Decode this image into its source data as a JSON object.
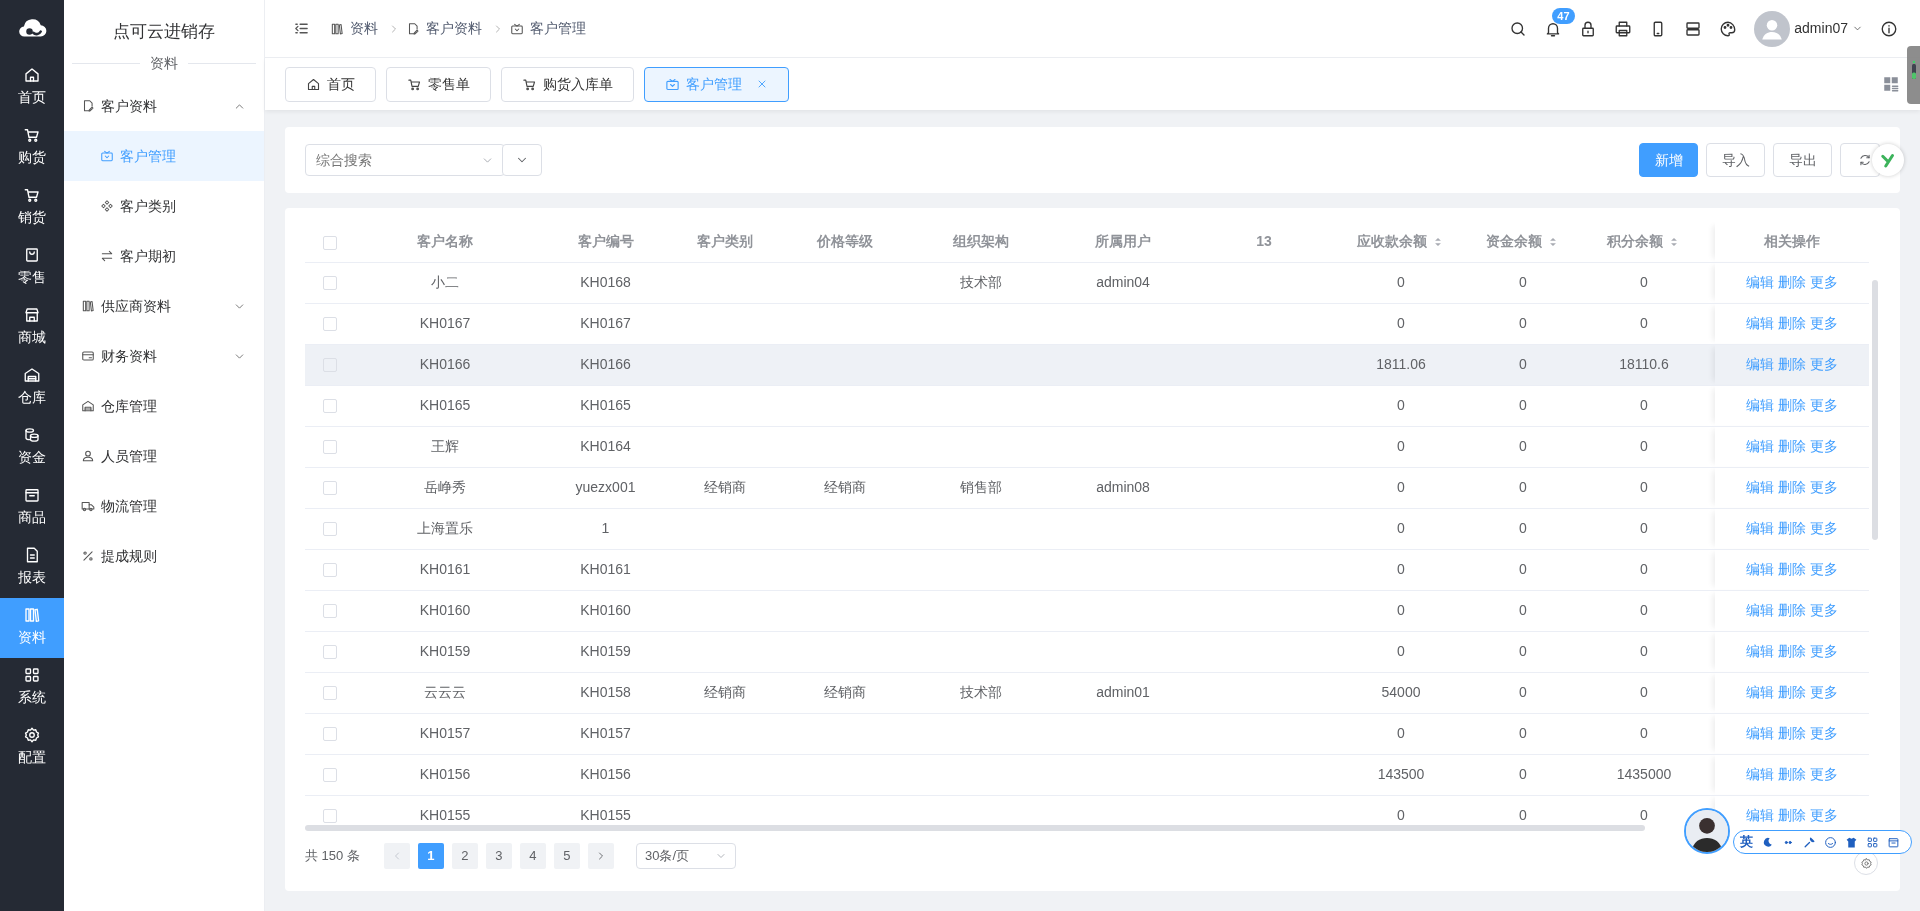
{
  "app": {
    "title": "点可云进销存",
    "section": "资料"
  },
  "nav_rail": [
    {
      "label": "首页",
      "selected": false
    },
    {
      "label": "购货",
      "selected": false
    },
    {
      "label": "销货",
      "selected": false
    },
    {
      "label": "零售",
      "selected": false
    },
    {
      "label": "商城",
      "selected": false
    },
    {
      "label": "仓库",
      "selected": false
    },
    {
      "label": "资金",
      "selected": false
    },
    {
      "label": "商品",
      "selected": false
    },
    {
      "label": "报表",
      "selected": false
    },
    {
      "label": "资料",
      "selected": true
    },
    {
      "label": "系统",
      "selected": false
    },
    {
      "label": "配置",
      "selected": false
    }
  ],
  "side_menu": [
    {
      "label": "客户资料",
      "kind": "group",
      "expanded": true,
      "selected": false,
      "children": [
        {
          "label": "客户管理",
          "selected": true
        },
        {
          "label": "客户类别",
          "selected": false
        },
        {
          "label": "客户期初",
          "selected": false
        }
      ]
    },
    {
      "label": "供应商资料",
      "kind": "group",
      "expanded": false,
      "selected": false
    },
    {
      "label": "财务资料",
      "kind": "group",
      "expanded": false,
      "selected": false
    },
    {
      "label": "仓库管理",
      "kind": "link",
      "selected": false
    },
    {
      "label": "人员管理",
      "kind": "link",
      "selected": false
    },
    {
      "label": "物流管理",
      "kind": "link",
      "selected": false
    },
    {
      "label": "提成规则",
      "kind": "link",
      "selected": false
    }
  ],
  "breadcrumb": [
    "资料",
    "客户资料",
    "客户管理"
  ],
  "header": {
    "notifications": "47",
    "user": "admin07"
  },
  "tabs": [
    {
      "label": "首页",
      "selected": false,
      "closable": false
    },
    {
      "label": "零售单",
      "selected": false,
      "closable": false
    },
    {
      "label": "购货入库单",
      "selected": false,
      "closable": false
    },
    {
      "label": "客户管理",
      "selected": true,
      "closable": true
    }
  ],
  "search": {
    "placeholder": "综合搜索"
  },
  "toolbar_buttons": [
    {
      "label": "新增",
      "kind": "primary"
    },
    {
      "label": "导入",
      "kind": "default"
    },
    {
      "label": "导出",
      "kind": "default"
    }
  ],
  "table": {
    "header_checked": false,
    "columns": [
      {
        "label": "客户名称",
        "sortable": false
      },
      {
        "label": "客户编号",
        "sortable": false
      },
      {
        "label": "客户类别",
        "sortable": false
      },
      {
        "label": "价格等级",
        "sortable": false
      },
      {
        "label": "组织架构",
        "sortable": false
      },
      {
        "label": "所属用户",
        "sortable": false
      },
      {
        "label": "13",
        "sortable": false
      },
      {
        "label": "应收款余额",
        "sortable": true
      },
      {
        "label": "资金余额",
        "sortable": true
      },
      {
        "label": "积分余额",
        "sortable": true
      },
      {
        "label": "相关操作",
        "sortable": false
      }
    ],
    "rows": [
      {
        "checked": false,
        "highlighted": false,
        "name": "小二",
        "code": "KH0168",
        "org": "技术部",
        "user": "admin04",
        "receivable": "0",
        "funds": "0",
        "points": "0",
        "actions": [
          "编辑",
          "删除",
          "更多"
        ]
      },
      {
        "checked": false,
        "highlighted": false,
        "name": "KH0167",
        "code": "KH0167",
        "receivable": "0",
        "funds": "0",
        "points": "0",
        "actions": [
          "编辑",
          "删除",
          "更多"
        ]
      },
      {
        "checked": false,
        "highlighted": true,
        "name": "KH0166",
        "code": "KH0166",
        "receivable": "1811.06",
        "funds": "0",
        "points": "18110.6",
        "actions": [
          "编辑",
          "删除",
          "更多"
        ]
      },
      {
        "checked": false,
        "highlighted": false,
        "name": "KH0165",
        "code": "KH0165",
        "receivable": "0",
        "funds": "0",
        "points": "0",
        "actions": [
          "编辑",
          "删除",
          "更多"
        ]
      },
      {
        "checked": false,
        "highlighted": false,
        "name": "王辉",
        "code": "KH0164",
        "receivable": "0",
        "funds": "0",
        "points": "0",
        "actions": [
          "编辑",
          "删除",
          "更多"
        ]
      },
      {
        "checked": false,
        "highlighted": false,
        "name": "岳峥秀",
        "code": "yuezx001",
        "category": "经销商",
        "price_level": "经销商",
        "org": "销售部",
        "user": "admin08",
        "receivable": "0",
        "funds": "0",
        "points": "0",
        "actions": [
          "编辑",
          "删除",
          "更多"
        ]
      },
      {
        "checked": false,
        "highlighted": false,
        "name": "上海置乐",
        "code": "1",
        "receivable": "0",
        "funds": "0",
        "points": "0",
        "actions": [
          "编辑",
          "删除",
          "更多"
        ]
      },
      {
        "checked": false,
        "highlighted": false,
        "name": "KH0161",
        "code": "KH0161",
        "receivable": "0",
        "funds": "0",
        "points": "0",
        "actions": [
          "编辑",
          "删除",
          "更多"
        ]
      },
      {
        "checked": false,
        "highlighted": false,
        "name": "KH0160",
        "code": "KH0160",
        "receivable": "0",
        "funds": "0",
        "points": "0",
        "actions": [
          "编辑",
          "删除",
          "更多"
        ]
      },
      {
        "checked": false,
        "highlighted": false,
        "name": "KH0159",
        "code": "KH0159",
        "receivable": "0",
        "funds": "0",
        "points": "0",
        "actions": [
          "编辑",
          "删除",
          "更多"
        ]
      },
      {
        "checked": false,
        "highlighted": false,
        "name": "云云云",
        "code": "KH0158",
        "category": "经销商",
        "price_level": "经销商",
        "org": "技术部",
        "user": "admin01",
        "receivable": "54000",
        "funds": "0",
        "points": "0",
        "actions": [
          "编辑",
          "删除",
          "更多"
        ]
      },
      {
        "checked": false,
        "highlighted": false,
        "name": "KH0157",
        "code": "KH0157",
        "receivable": "0",
        "funds": "0",
        "points": "0",
        "actions": [
          "编辑",
          "删除",
          "更多"
        ]
      },
      {
        "checked": false,
        "highlighted": false,
        "name": "KH0156",
        "code": "KH0156",
        "receivable": "143500",
        "funds": "0",
        "points": "1435000",
        "actions": [
          "编辑",
          "删除",
          "更多"
        ]
      },
      {
        "checked": false,
        "highlighted": false,
        "name": "KH0155",
        "code": "KH0155",
        "receivable": "0",
        "funds": "0",
        "points": "0",
        "actions": [
          "编辑",
          "删除",
          "更多"
        ]
      }
    ]
  },
  "pagination": {
    "total": "共 150 条",
    "pages": [
      {
        "label": "1",
        "selected": true
      },
      {
        "label": "2",
        "selected": false
      },
      {
        "label": "3",
        "selected": false
      },
      {
        "label": "4",
        "selected": false
      },
      {
        "label": "5",
        "selected": false
      }
    ],
    "page_size": "30条/页"
  },
  "ime_toolbar": {
    "mode": "英"
  }
}
